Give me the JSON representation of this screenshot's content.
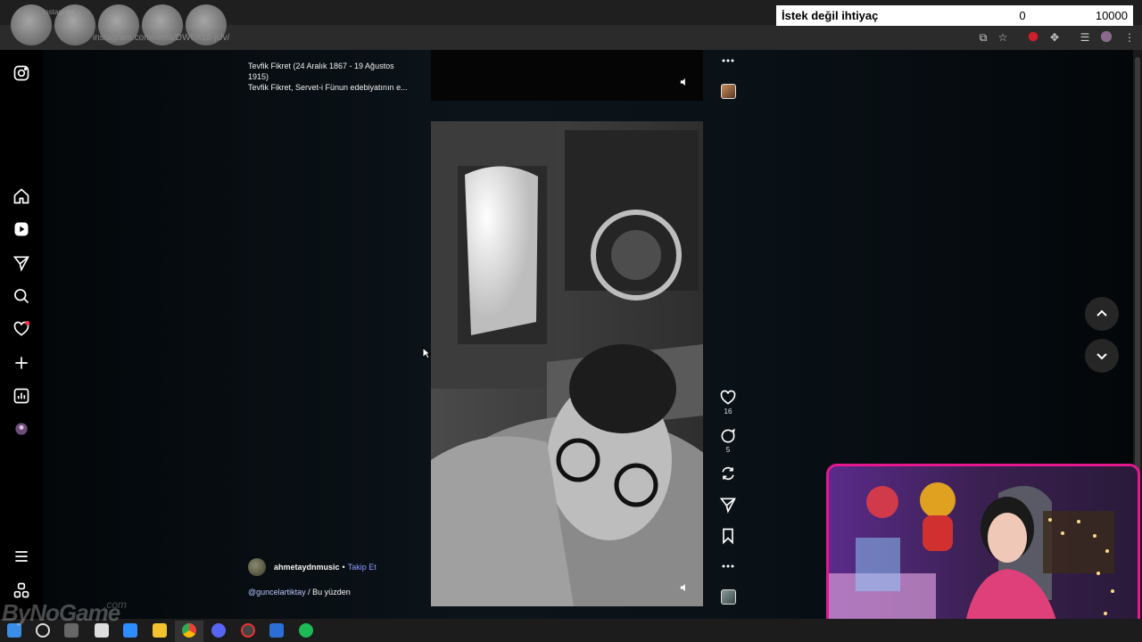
{
  "browser": {
    "tab_title": "Instagram",
    "url": "instagram.com/reels/DW6X18-jUv/"
  },
  "counter": {
    "label": "İstek değil ihtiyaç",
    "current": "0",
    "goal": "10000"
  },
  "sidebar": {
    "items": [
      "instagram-logo",
      "home",
      "reels",
      "messages",
      "search",
      "notifications",
      "create",
      "dashboard",
      "profile",
      "more",
      "also-from-meta"
    ]
  },
  "previous_post": {
    "caption_line1": "Tevfik Fikret (24 Aralık 1867 - 19 Ağustos",
    "caption_line2": "1915)",
    "caption_line3": "Tevfik Fikret, Servet-i Fünun edebiyatının e..."
  },
  "current_post": {
    "username": "ahmetaydnmusic",
    "separator": "•",
    "follow_label": "Takip Et",
    "caption_mention": "@guncelartiktay",
    "caption_text": " / Bu yüzden",
    "likes": "16",
    "comments": "5"
  },
  "colors": {
    "accent": "#e6178f",
    "follow": "#8f9bff",
    "counter_bg": "#ffffff"
  },
  "watermark": {
    "text": "ByNoGame",
    "suffix": ".com"
  }
}
